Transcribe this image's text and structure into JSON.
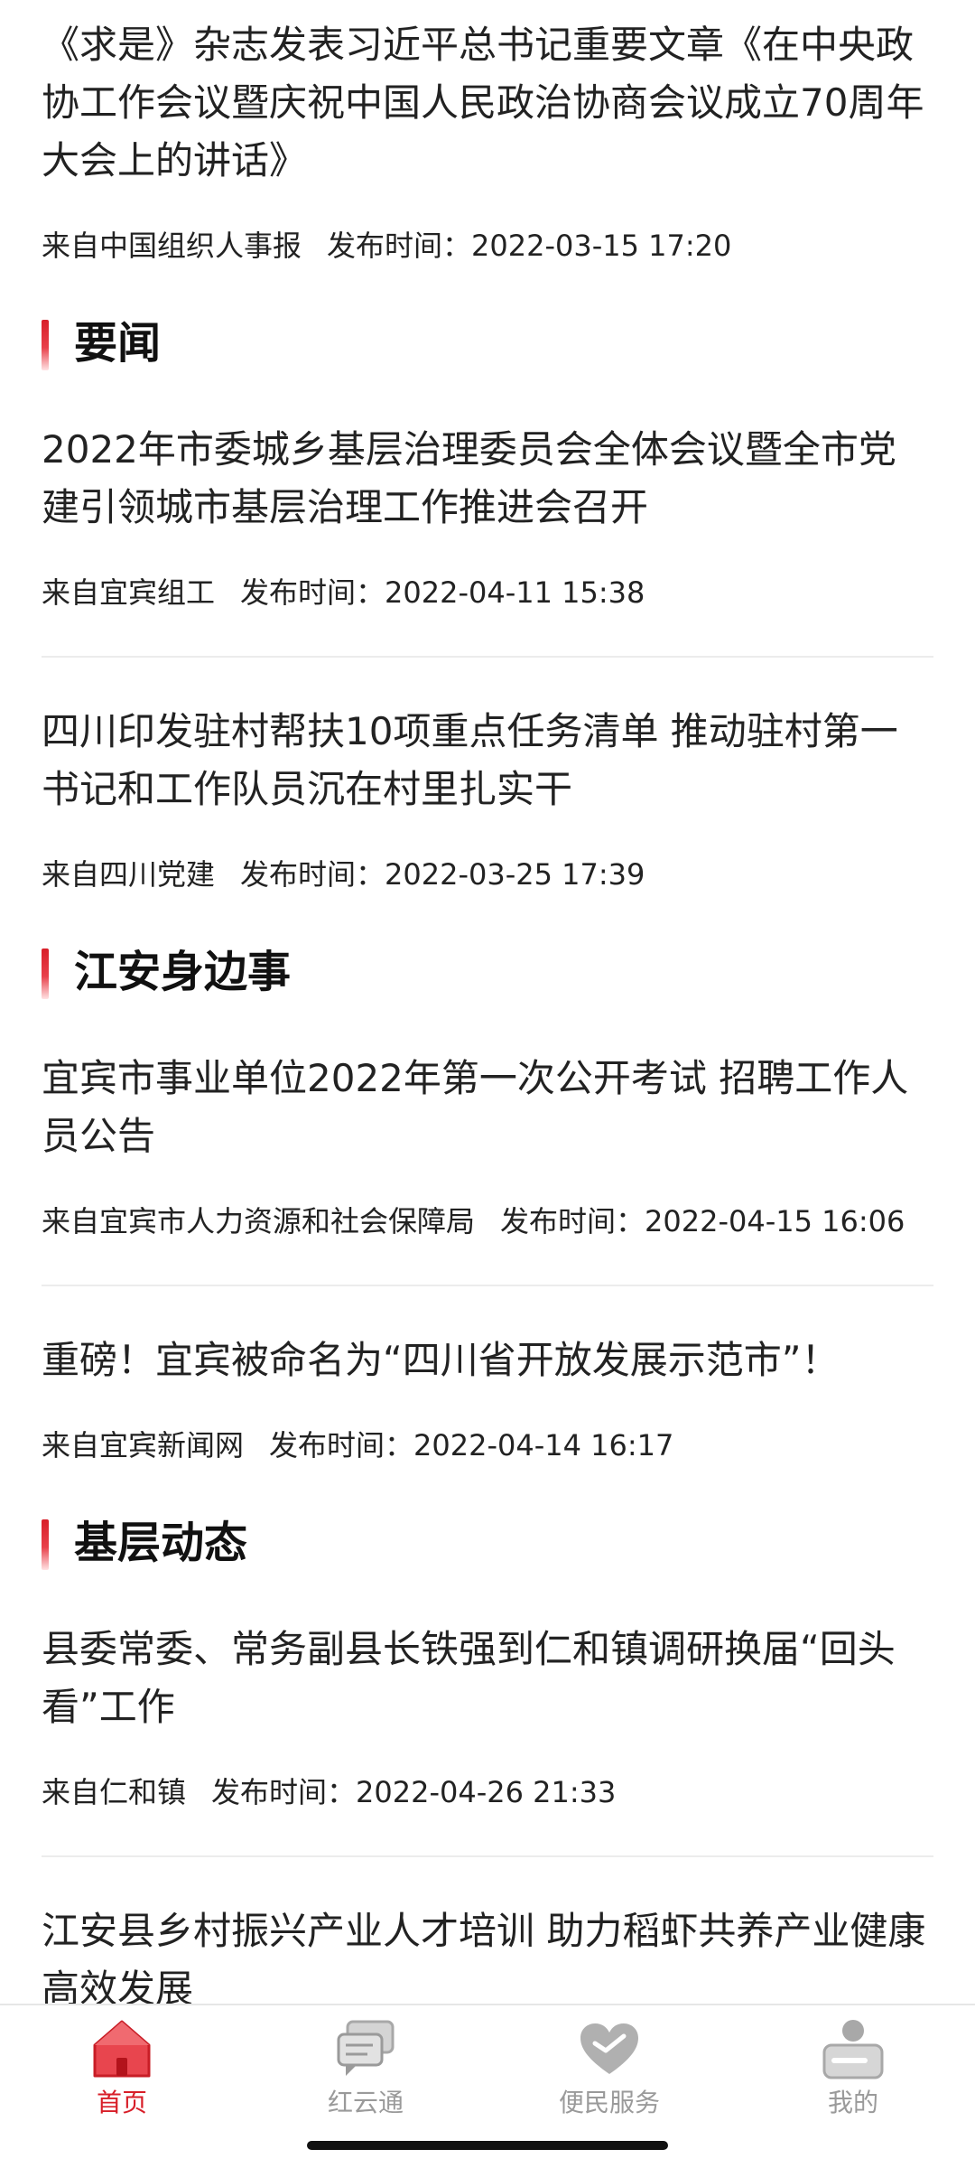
{
  "top_article": {
    "title": "《求是》杂志发表习近平总书记重要文章《在中央政协工作会议暨庆祝中国人民政治协商会议成立70周年大会上的讲话》",
    "source": "来自中国组织人事报",
    "published": "发布时间：2022-03-15 17:20"
  },
  "sections": [
    {
      "heading": "要闻",
      "articles": [
        {
          "title": "2022年市委城乡基层治理委员会全体会议暨全市党建引领城市基层治理工作推进会召开",
          "source": "来自宜宾组工",
          "published": "发布时间：2022-04-11 15:38"
        },
        {
          "title": "四川印发驻村帮扶10项重点任务清单 推动驻村第一书记和工作队员沉在村里扎实干",
          "source": "来自四川党建",
          "published": "发布时间：2022-03-25 17:39"
        }
      ]
    },
    {
      "heading": "江安身边事",
      "articles": [
        {
          "title": "宜宾市事业单位2022年第一次公开考试 招聘工作人员公告",
          "source": "来自宜宾市人力资源和社会保障局",
          "published": "发布时间：2022-04-15 16:06"
        },
        {
          "title": "重磅！宜宾被命名为“四川省开放发展示范市”！",
          "source": "来自宜宾新闻网",
          "published": "发布时间：2022-04-14 16:17"
        }
      ]
    },
    {
      "heading": "基层动态",
      "articles": [
        {
          "title": "县委常委、常务副县长铁强到仁和镇调研换届“回头看”工作",
          "source": "来自仁和镇",
          "published": "发布时间：2022-04-26 21:33"
        },
        {
          "title": "江安县乡村振兴产业人才培训 助力稻虾共养产业健康高效发展",
          "source": "",
          "published": ""
        }
      ]
    }
  ],
  "tabbar": {
    "items": [
      {
        "label": "首页",
        "icon": "home-icon",
        "active": true
      },
      {
        "label": "红云通",
        "icon": "chat-icon",
        "active": false
      },
      {
        "label": "便民服务",
        "icon": "heart-icon",
        "active": false
      },
      {
        "label": "我的",
        "icon": "profile-icon",
        "active": false
      }
    ]
  },
  "colors": {
    "accent": "#d81e28",
    "inactive": "#9a9a9a",
    "text": "#222222",
    "divider": "#ececec"
  }
}
